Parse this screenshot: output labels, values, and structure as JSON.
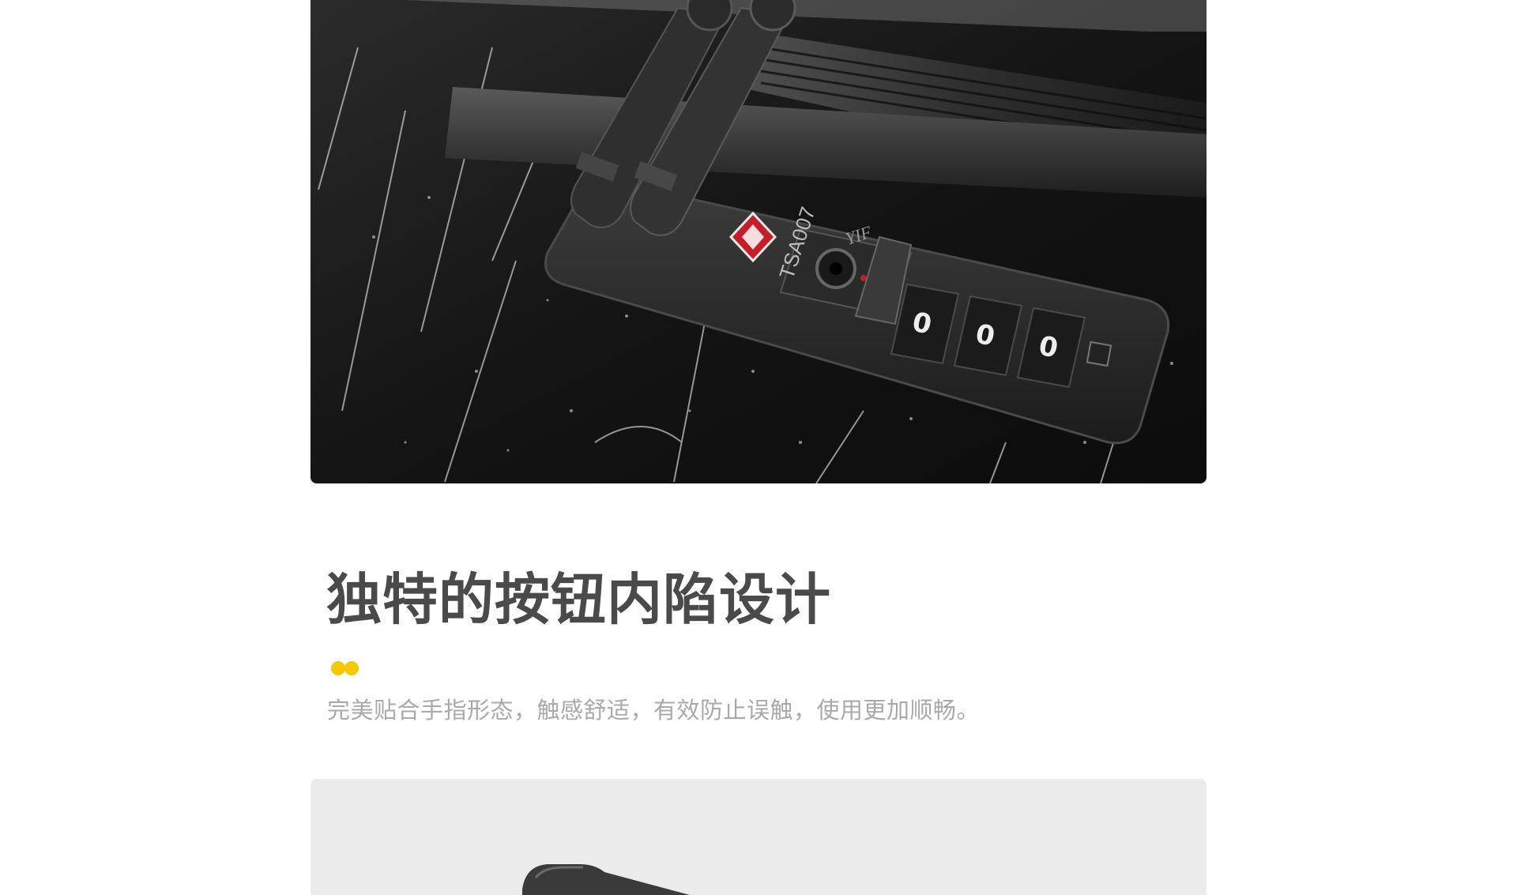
{
  "top_image": {
    "lock_label": "TSA007",
    "brand_mark": "YIF"
  },
  "feature": {
    "title": "独特的按钮内陷设计",
    "description": "完美贴合手指形态，触感舒适，有效防止误触，使用更加顺畅。",
    "accent_color": "#f5c800"
  },
  "colors": {
    "title": "#4a4a4a",
    "description": "#a9a9a9",
    "bottom_image_bg": "#ebebeb"
  }
}
